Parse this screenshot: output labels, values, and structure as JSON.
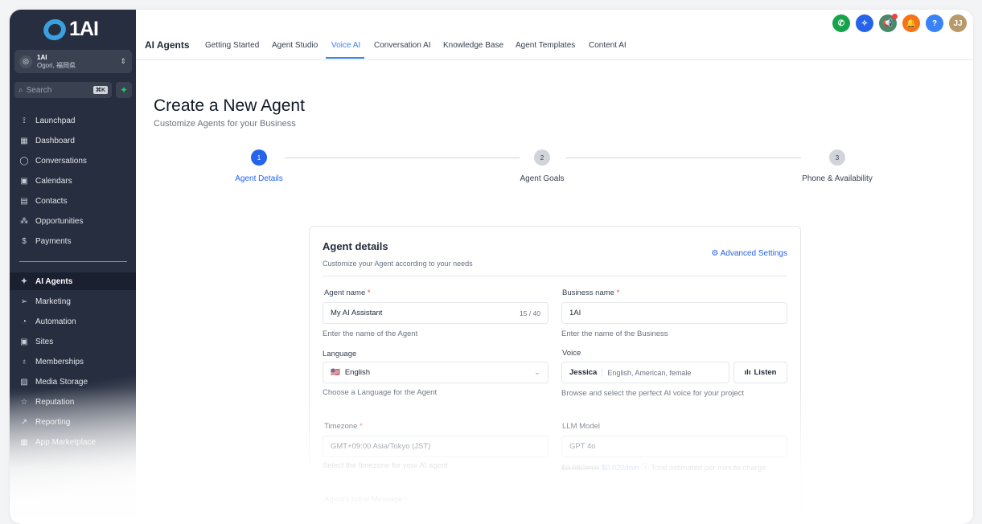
{
  "brand": "1AI",
  "account": {
    "name": "1AI",
    "location": "Ogori, 福岡県"
  },
  "search": {
    "placeholder": "Search",
    "shortcut": "⌘K"
  },
  "sidebar": {
    "items": [
      {
        "label": "Launchpad",
        "icon": "rocket-icon"
      },
      {
        "label": "Dashboard",
        "icon": "grid-icon"
      },
      {
        "label": "Conversations",
        "icon": "chat-icon"
      },
      {
        "label": "Calendars",
        "icon": "calendar-icon"
      },
      {
        "label": "Contacts",
        "icon": "contacts-icon"
      },
      {
        "label": "Opportunities",
        "icon": "opportunities-icon"
      },
      {
        "label": "Payments",
        "icon": "payments-icon"
      }
    ],
    "items2": [
      {
        "label": "AI Agents"
      },
      {
        "label": "Marketing"
      },
      {
        "label": "Automation"
      },
      {
        "label": "Sites"
      },
      {
        "label": "Memberships"
      },
      {
        "label": "Media Storage"
      },
      {
        "label": "Reputation"
      },
      {
        "label": "Reporting"
      },
      {
        "label": "App Marketplace"
      }
    ]
  },
  "header": {
    "title": "AI Agents",
    "tabs": [
      "Getting Started",
      "Agent Studio",
      "Voice AI",
      "Conversation AI",
      "Knowledge Base",
      "Agent Templates",
      "Content AI"
    ],
    "avatar": "JJ"
  },
  "page": {
    "title": "Create a New Agent",
    "subtitle": "Customize Agents for your Business"
  },
  "steps": [
    {
      "n": "1",
      "label": "Agent Details"
    },
    {
      "n": "2",
      "label": "Agent Goals"
    },
    {
      "n": "3",
      "label": "Phone & Availability"
    }
  ],
  "card": {
    "title": "Agent details",
    "subtitle": "Customize your Agent according to your needs",
    "advanced": "Advanced Settings",
    "agent_name": {
      "label": "Agent name",
      "value": "My AI Assistant",
      "count": "15 / 40",
      "hint": "Enter the name of the Agent"
    },
    "business_name": {
      "label": "Business name",
      "value": "1AI",
      "hint": "Enter the name of the Business"
    },
    "language": {
      "label": "Language",
      "value": "English",
      "hint": "Choose a Language for the Agent"
    },
    "voice": {
      "label": "Voice",
      "name": "Jessica",
      "desc": "English, American, female",
      "listen": "Listen",
      "hint": "Browse and select the perfect AI voice for your project"
    },
    "timezone": {
      "label": "Timezone",
      "value": "GMT+09:00 Asia/Tokyo (JST)",
      "hint": "Select the timezone for your AI agent"
    },
    "llm": {
      "label": "LLM Model",
      "value": "GPT 4o",
      "old_price": "$0.080/min",
      "price": "$0.020/min",
      "hint": "Total estimated per minute charge"
    },
    "initial_message": {
      "label": "Agent's Initial Message"
    }
  },
  "required_mark": "*"
}
